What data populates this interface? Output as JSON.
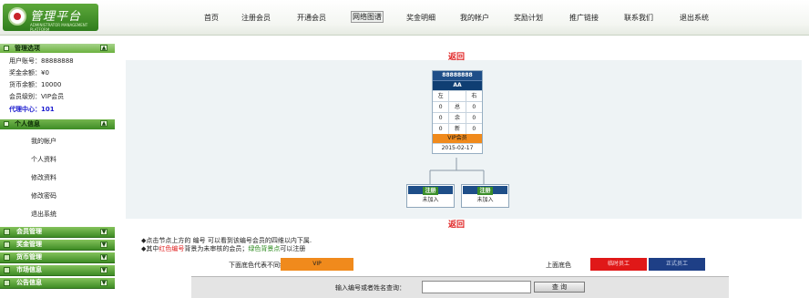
{
  "header": {
    "logo_title": "管理平台",
    "logo_sub": "ADMINISTRATOR MANAGEMENT PLATFORM",
    "nav": [
      "首页",
      "注册会员",
      "开通会员",
      "网络图谱",
      "奖金明细",
      "我的帐户",
      "奖励计划",
      "推广链接",
      "联系我们",
      "退出系统"
    ],
    "active_nav": "网络图谱"
  },
  "sidebar": {
    "panel_title": "管理选项",
    "info": {
      "account": "用户账号：88888888",
      "bonus": "奖金余额：¥0",
      "coins": "货币余额：10000",
      "level": "会员级别：VIP会员",
      "agent": "代理中心：101"
    },
    "personal_title": "个人信息",
    "personal_items": [
      "我的帐户",
      "个人资料",
      "修改资料",
      "修改密码",
      "退出系统"
    ],
    "sections": [
      "会员管理",
      "奖金管理",
      "货币管理",
      "市场信息",
      "公告信息"
    ]
  },
  "main": {
    "back_label": "返回",
    "root": {
      "id": "88888888",
      "name": "AA",
      "left_head": "左",
      "right_head": "右",
      "rows": [
        {
          "left": "0",
          "mid": "总",
          "right": "0"
        },
        {
          "left": "0",
          "mid": "余",
          "right": "0"
        },
        {
          "left": "0",
          "mid": "新",
          "right": "0"
        }
      ],
      "level": "VIP会员",
      "date": "2015-02-17"
    },
    "children": [
      {
        "badge": "注册",
        "status": "未加入"
      },
      {
        "badge": "注册",
        "status": "未加入"
      }
    ],
    "notes": [
      {
        "a": "◆点击节点上方的 编号 可以看到该编号会员的四维以内下属."
      },
      {
        "a": "◆其中",
        "red": "红色编号",
        "b": "背景为未审核的会员；",
        "green": "绿色背景点",
        "c": "可以注册"
      }
    ]
  },
  "legend": {
    "left_label": "下面底色代表不同级别",
    "level_box": "VIP",
    "right_label": "上面底色",
    "box2": "临时员工",
    "box3": "正式员工",
    "colors": {
      "vip": "#f08a1c",
      "temp": "#e01818",
      "formal": "#1e3f86"
    }
  },
  "search": {
    "label": "输入编号或者姓名查询：",
    "value": "",
    "button": "查 询"
  }
}
